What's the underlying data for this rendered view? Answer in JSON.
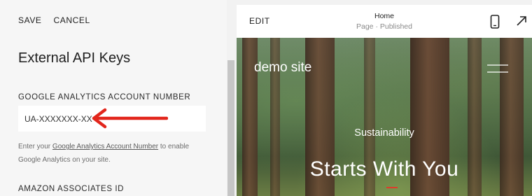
{
  "toolbar": {
    "save_label": "SAVE",
    "cancel_label": "CANCEL"
  },
  "panel": {
    "title": "External API Keys",
    "ga_label": "GOOGLE ANALYTICS ACCOUNT NUMBER",
    "ga_value": "UA-XXXXXXX-XX",
    "helper_prefix": "Enter your ",
    "helper_link": "Google Analytics Account Number",
    "helper_suffix": " to enable Google Analytics on your site.",
    "amazon_label": "AMAZON ASSOCIATES ID"
  },
  "preview": {
    "edit_label": "EDIT",
    "page_name": "Home",
    "page_status": "Page · Published",
    "site_name": "demo site",
    "hero_subtitle": "Sustainability",
    "hero_title": "Starts With You"
  },
  "colors": {
    "arrow": "#e2261c",
    "accent": "#e03a2b"
  }
}
